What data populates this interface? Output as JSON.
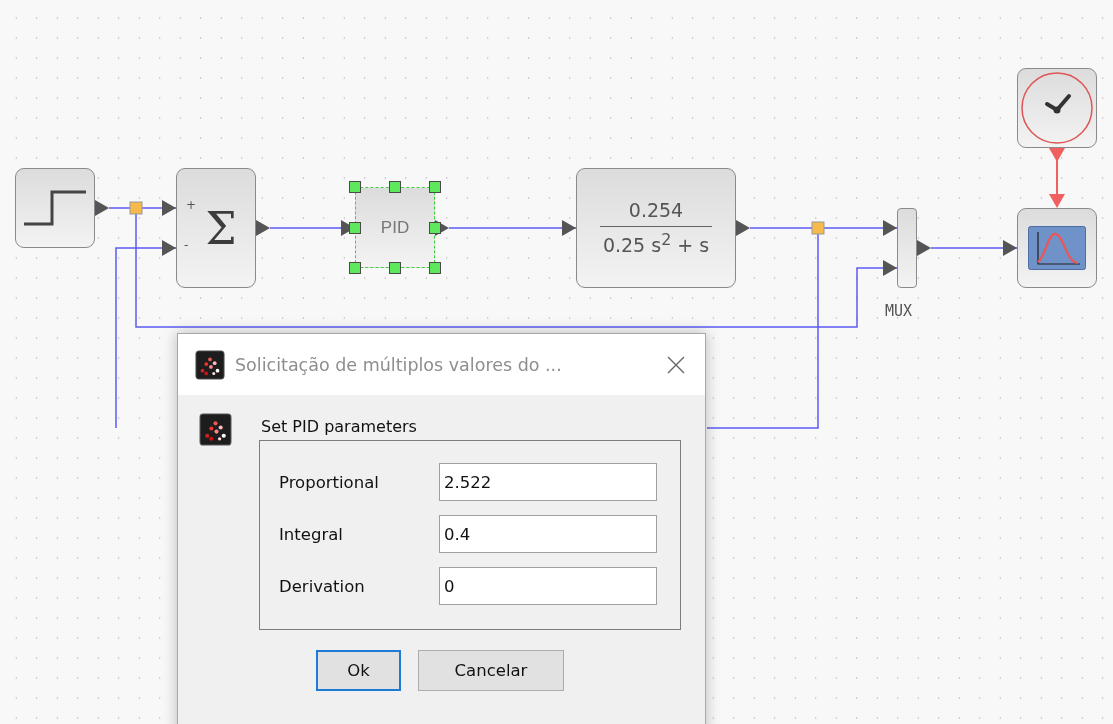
{
  "diagram": {
    "blocks": [
      {
        "kind": "step"
      },
      {
        "kind": "sum",
        "symbol": "Σ",
        "signs": [
          "+",
          "-"
        ]
      },
      {
        "kind": "pid",
        "label": "PID",
        "selected": true
      },
      {
        "kind": "transfer",
        "numerator": "0.254",
        "denominator": "0.25 s$^{2}$ + s"
      },
      {
        "kind": "mux",
        "label": "MUX"
      },
      {
        "kind": "clock"
      },
      {
        "kind": "scope"
      }
    ]
  },
  "dialog": {
    "title": "Solicitação de múltiplos valores do ...",
    "heading": "Set PID parameters",
    "fields": [
      {
        "label": "Proportional",
        "value": "2.522"
      },
      {
        "label": "Integral",
        "value": "0.4"
      },
      {
        "label": "Derivation",
        "value": "0"
      }
    ],
    "buttons": [
      {
        "label": "Ok",
        "focused": true
      },
      {
        "label": "Cancelar",
        "focused": false
      }
    ]
  }
}
